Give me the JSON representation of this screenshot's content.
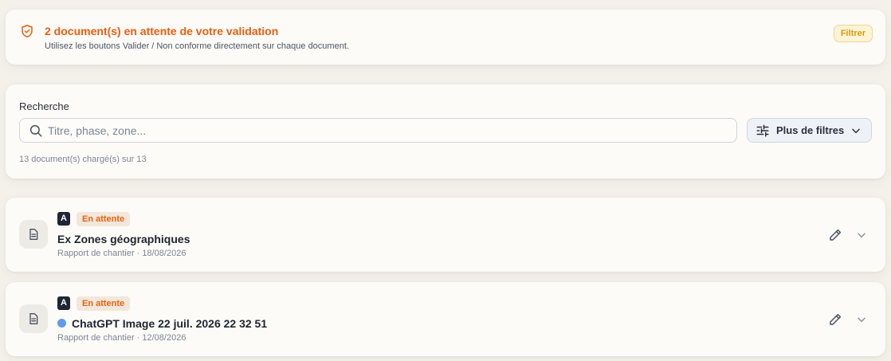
{
  "alert": {
    "icon": "shield-check-icon",
    "title": "2 document(s) en attente de votre validation",
    "subtitle": "Utilisez les boutons Valider / Non conforme directement sur chaque document.",
    "filter_label": "Filtrer",
    "title_color": "#e85d10"
  },
  "search": {
    "label": "Recherche",
    "placeholder": "Titre, phase, zone...",
    "value": "",
    "more_filters_label": "Plus de filtres",
    "count_text": "13 document(s) chargé(s) sur 13"
  },
  "documents": [
    {
      "avatar_letter": "A",
      "status": "En attente",
      "title": "Ex Zones géographiques",
      "meta": "Rapport de chantier · 18/08/2026",
      "has_dot": false
    },
    {
      "avatar_letter": "A",
      "status": "En attente",
      "title": "ChatGPT Image 22 juil. 2026 22 32 51",
      "meta": "Rapport de chantier · 12/08/2026",
      "has_dot": true,
      "dot_color": "#6398f2"
    }
  ]
}
